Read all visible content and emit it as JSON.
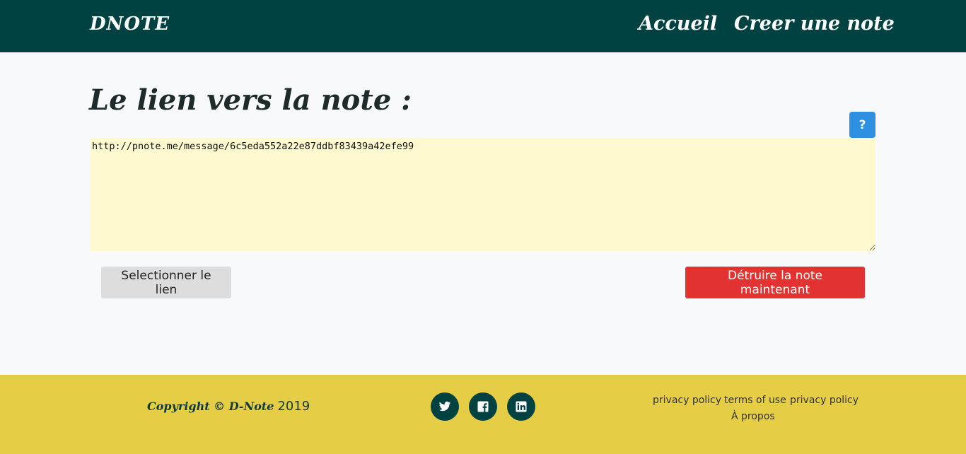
{
  "navbar": {
    "brand": "DNOTE",
    "links": [
      "Accueil",
      "Creer une note"
    ],
    "background_color": "#004242"
  },
  "main": {
    "title": "Le lien vers la note :",
    "help_label": "?",
    "link_value": "http://pnote.me/message/6c5eda552a22e87ddbf83439a42efe99",
    "select_button": "Selectionner le lien",
    "destroy_button": "Détruire la note maintenant",
    "colors": {
      "textarea_bg": "#fef9cf",
      "help_button": "#2f8fe0",
      "destroy_button": "#e33232"
    }
  },
  "footer": {
    "copyright_text": "Copyright © D-Note",
    "year": "2019",
    "social_icons": [
      "twitter-icon",
      "facebook-icon",
      "linkedin-icon"
    ],
    "links": [
      "privacy policy",
      "terms of use",
      "privacy policy",
      "À propos"
    ],
    "background_color": "#e5cd45"
  }
}
